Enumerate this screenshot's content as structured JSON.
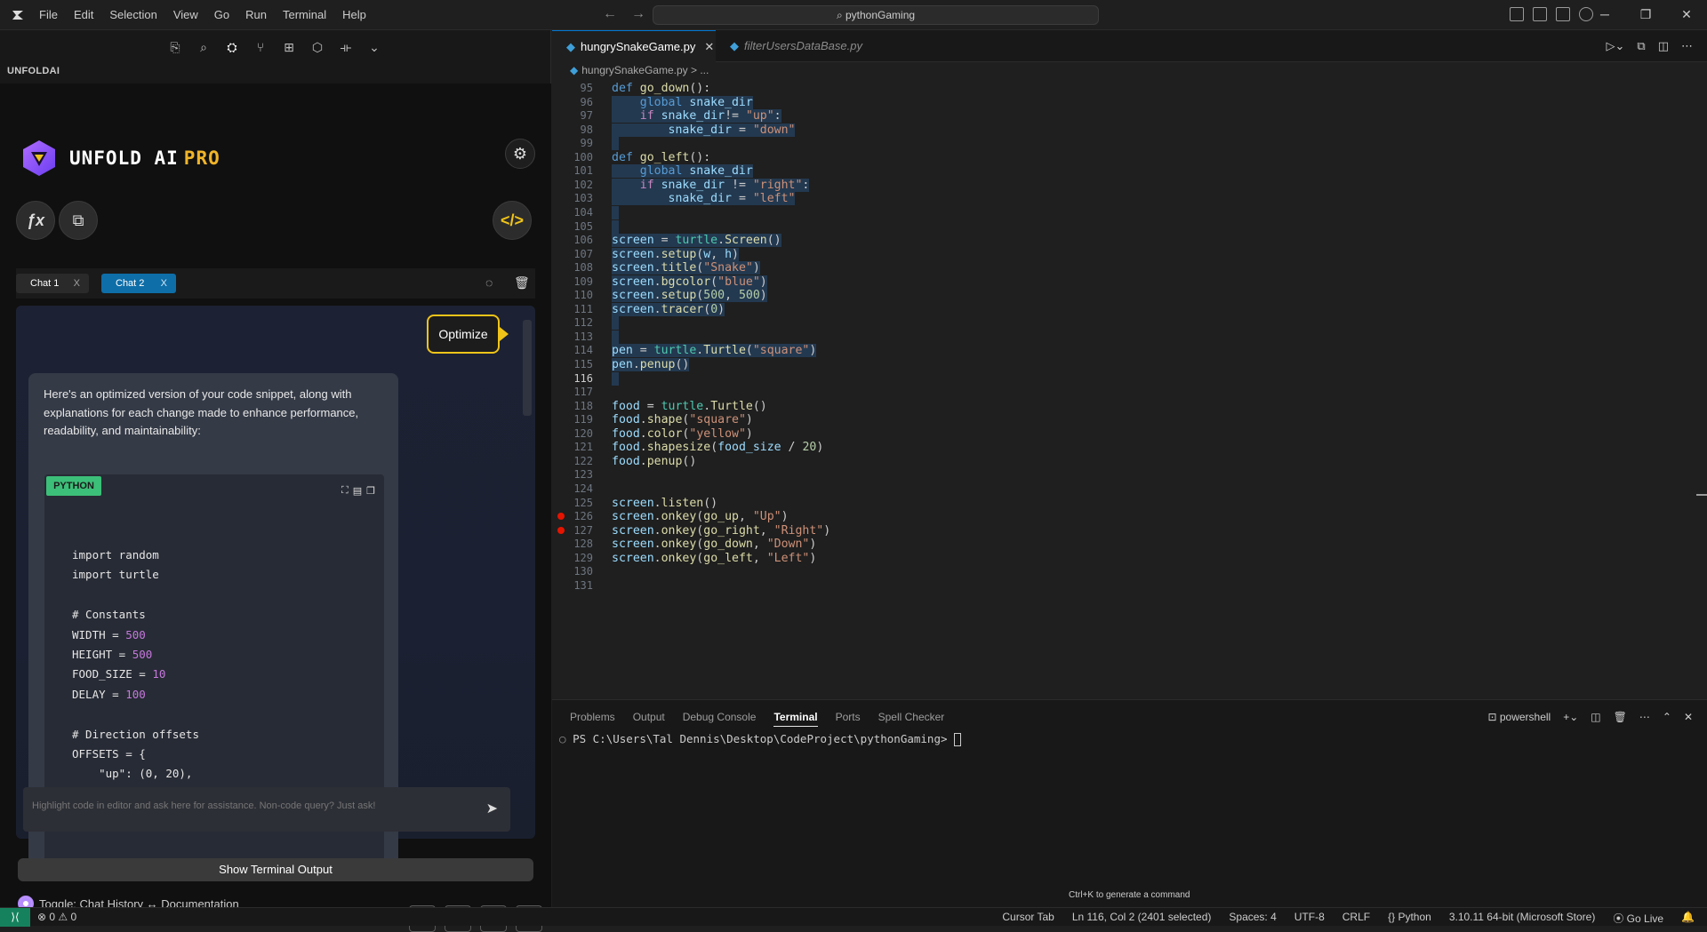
{
  "titlebar": {
    "menu": [
      "File",
      "Edit",
      "Selection",
      "View",
      "Go",
      "Run",
      "Terminal",
      "Help"
    ],
    "search": "pythonGaming",
    "window_controls": [
      "─",
      "❐",
      "✕"
    ]
  },
  "left_panel": {
    "title": "UNFOLDAI",
    "brand_name": "UNFOLD AI",
    "brand_tier": "PRO",
    "fx_icon": "ƒx",
    "chat_tabs": [
      {
        "label": "Chat 1",
        "close": "X"
      },
      {
        "label": "Chat 2",
        "close": "X"
      }
    ],
    "optimize_label": "Optimize",
    "message_text": "Here's an optimized version of your code snippet, along with explanations for each change made to enhance performance, readability, and maintainability:",
    "code_language": "PYTHON",
    "code_lines": [
      {
        "parts": [
          {
            "t": "import random"
          }
        ]
      },
      {
        "parts": [
          {
            "t": "import turtle"
          }
        ]
      },
      {
        "parts": [
          {
            "t": ""
          }
        ]
      },
      {
        "parts": [
          {
            "t": "# Constants"
          }
        ]
      },
      {
        "parts": [
          {
            "t": "WIDTH = "
          },
          {
            "t": "500",
            "c": "num"
          }
        ]
      },
      {
        "parts": [
          {
            "t": "HEIGHT = "
          },
          {
            "t": "500",
            "c": "num"
          }
        ]
      },
      {
        "parts": [
          {
            "t": "FOOD_SIZE = "
          },
          {
            "t": "10",
            "c": "num"
          }
        ]
      },
      {
        "parts": [
          {
            "t": "DELAY = "
          },
          {
            "t": "100",
            "c": "num"
          }
        ]
      },
      {
        "parts": [
          {
            "t": ""
          }
        ]
      },
      {
        "parts": [
          {
            "t": "# Direction offsets"
          }
        ]
      },
      {
        "parts": [
          {
            "t": "OFFSETS = {"
          }
        ]
      },
      {
        "parts": [
          {
            "t": "    \"up\": (0, 20),"
          }
        ]
      }
    ],
    "input_placeholder": "Highlight code in editor and ask here for assistance. Non-code query? Just ask!",
    "show_terminal_label": "Show Terminal Output",
    "toggle_label": "Toggle: Chat History ↔ Documentation"
  },
  "editor": {
    "tabs": [
      {
        "label": "hungrySnakeGame.py",
        "active": true
      },
      {
        "label": "filterUsersDataBase.py",
        "active": false
      }
    ],
    "breadcrumb_file": "hungrySnakeGame.py",
    "breadcrumb_rest": "> ...",
    "current_line": 116,
    "breakpoints": [
      126,
      127
    ],
    "lines": [
      {
        "n": 95,
        "y": 0,
        "sel": false,
        "parts": [
          {
            "t": "def ",
            "c": "kw"
          },
          {
            "t": "go_down",
            "c": "fn"
          },
          {
            "t": "():"
          }
        ]
      },
      {
        "n": 96,
        "y": 1,
        "sel": true,
        "parts": [
          {
            "t": "    "
          },
          {
            "t": "global ",
            "c": "kw"
          },
          {
            "t": "snake_dir",
            "c": "vr"
          }
        ]
      },
      {
        "n": 97,
        "y": 2,
        "sel": true,
        "parts": [
          {
            "t": "    "
          },
          {
            "t": "if ",
            "c": "kwc"
          },
          {
            "t": "snake_dir",
            "c": "vr"
          },
          {
            "t": "!= "
          },
          {
            "t": "\"up\"",
            "c": "str"
          },
          {
            "t": ":"
          }
        ]
      },
      {
        "n": 98,
        "y": 3,
        "sel": true,
        "parts": [
          {
            "t": "        "
          },
          {
            "t": "snake_dir",
            "c": "vr"
          },
          {
            "t": " = "
          },
          {
            "t": "\"down\"",
            "c": "str"
          }
        ]
      },
      {
        "n": 99,
        "y": 4,
        "sel": true,
        "parts": [
          {
            "t": " "
          }
        ]
      },
      {
        "n": 100,
        "y": 5,
        "sel": false,
        "parts": [
          {
            "t": "def ",
            "c": "kw"
          },
          {
            "t": "go_left",
            "c": "fn"
          },
          {
            "t": "():"
          }
        ]
      },
      {
        "n": 101,
        "y": 6,
        "sel": true,
        "parts": [
          {
            "t": "    "
          },
          {
            "t": "global ",
            "c": "kw"
          },
          {
            "t": "snake_dir",
            "c": "vr"
          }
        ]
      },
      {
        "n": 102,
        "y": 7,
        "sel": true,
        "parts": [
          {
            "t": "    "
          },
          {
            "t": "if ",
            "c": "kwc"
          },
          {
            "t": "snake_dir",
            "c": "vr"
          },
          {
            "t": " != "
          },
          {
            "t": "\"right\"",
            "c": "str"
          },
          {
            "t": ":"
          }
        ]
      },
      {
        "n": 103,
        "y": 8,
        "sel": true,
        "parts": [
          {
            "t": "        "
          },
          {
            "t": "snake_dir",
            "c": "vr"
          },
          {
            "t": " = "
          },
          {
            "t": "\"left\"",
            "c": "str"
          }
        ]
      },
      {
        "n": 104,
        "y": 9,
        "sel": true,
        "parts": [
          {
            "t": " "
          }
        ]
      },
      {
        "n": 105,
        "y": 10,
        "sel": true,
        "parts": [
          {
            "t": " "
          }
        ]
      },
      {
        "n": 106,
        "y": 11,
        "sel": true,
        "parts": [
          {
            "t": "screen",
            "c": "vr"
          },
          {
            "t": " = "
          },
          {
            "t": "turtle",
            "c": "md"
          },
          {
            "t": "."
          },
          {
            "t": "Screen",
            "c": "fn"
          },
          {
            "t": "()"
          }
        ]
      },
      {
        "n": 107,
        "y": 12,
        "sel": true,
        "parts": [
          {
            "t": "screen",
            "c": "vr"
          },
          {
            "t": "."
          },
          {
            "t": "setup",
            "c": "fn"
          },
          {
            "t": "("
          },
          {
            "t": "w",
            "c": "vr"
          },
          {
            "t": ", "
          },
          {
            "t": "h",
            "c": "vr"
          },
          {
            "t": ")"
          }
        ]
      },
      {
        "n": 108,
        "y": 13,
        "sel": true,
        "parts": [
          {
            "t": "screen",
            "c": "vr"
          },
          {
            "t": "."
          },
          {
            "t": "title",
            "c": "fn"
          },
          {
            "t": "("
          },
          {
            "t": "\"Snake\"",
            "c": "str"
          },
          {
            "t": ")"
          }
        ]
      },
      {
        "n": 109,
        "y": 14,
        "sel": true,
        "parts": [
          {
            "t": "screen",
            "c": "vr"
          },
          {
            "t": "."
          },
          {
            "t": "bgcolor",
            "c": "fn"
          },
          {
            "t": "("
          },
          {
            "t": "\"blue\"",
            "c": "str"
          },
          {
            "t": ")"
          }
        ]
      },
      {
        "n": 110,
        "y": 15,
        "sel": true,
        "parts": [
          {
            "t": "screen",
            "c": "vr"
          },
          {
            "t": "."
          },
          {
            "t": "setup",
            "c": "fn"
          },
          {
            "t": "("
          },
          {
            "t": "500",
            "c": "nm"
          },
          {
            "t": ", "
          },
          {
            "t": "500",
            "c": "nm"
          },
          {
            "t": ")"
          }
        ]
      },
      {
        "n": 111,
        "y": 16,
        "sel": true,
        "parts": [
          {
            "t": "screen",
            "c": "vr"
          },
          {
            "t": "."
          },
          {
            "t": "tracer",
            "c": "fn"
          },
          {
            "t": "("
          },
          {
            "t": "0",
            "c": "nm"
          },
          {
            "t": ")"
          }
        ]
      },
      {
        "n": 112,
        "y": 17,
        "sel": true,
        "parts": [
          {
            "t": " "
          }
        ]
      },
      {
        "n": 113,
        "y": 18,
        "sel": true,
        "parts": [
          {
            "t": " "
          }
        ]
      },
      {
        "n": 114,
        "y": 19,
        "sel": true,
        "parts": [
          {
            "t": "pen",
            "c": "vr"
          },
          {
            "t": " = "
          },
          {
            "t": "turtle",
            "c": "md"
          },
          {
            "t": "."
          },
          {
            "t": "Turtle",
            "c": "fn"
          },
          {
            "t": "("
          },
          {
            "t": "\"square\"",
            "c": "str"
          },
          {
            "t": ")"
          }
        ]
      },
      {
        "n": 115,
        "y": 20,
        "sel": true,
        "parts": [
          {
            "t": "pen",
            "c": "vr"
          },
          {
            "t": "."
          },
          {
            "t": "penup",
            "c": "fn"
          },
          {
            "t": "()"
          }
        ]
      },
      {
        "n": 116,
        "y": 21,
        "sel": true,
        "parts": [
          {
            "t": " "
          }
        ]
      },
      {
        "n": 117,
        "y": 22,
        "sel": false,
        "parts": [
          {
            "t": ""
          }
        ]
      },
      {
        "n": 118,
        "y": 23,
        "sel": false,
        "parts": [
          {
            "t": "food",
            "c": "vr"
          },
          {
            "t": " = "
          },
          {
            "t": "turtle",
            "c": "md"
          },
          {
            "t": "."
          },
          {
            "t": "Turtle",
            "c": "fn"
          },
          {
            "t": "()"
          }
        ]
      },
      {
        "n": 119,
        "y": 24,
        "sel": false,
        "parts": [
          {
            "t": "food",
            "c": "vr"
          },
          {
            "t": "."
          },
          {
            "t": "shape",
            "c": "fn"
          },
          {
            "t": "("
          },
          {
            "t": "\"square\"",
            "c": "str"
          },
          {
            "t": ")"
          }
        ]
      },
      {
        "n": 120,
        "y": 25,
        "sel": false,
        "parts": [
          {
            "t": "food",
            "c": "vr"
          },
          {
            "t": "."
          },
          {
            "t": "color",
            "c": "fn"
          },
          {
            "t": "("
          },
          {
            "t": "\"yellow\"",
            "c": "str"
          },
          {
            "t": ")"
          }
        ]
      },
      {
        "n": 121,
        "y": 26,
        "sel": false,
        "parts": [
          {
            "t": "food",
            "c": "vr"
          },
          {
            "t": "."
          },
          {
            "t": "shapesize",
            "c": "fn"
          },
          {
            "t": "("
          },
          {
            "t": "food_size",
            "c": "vr"
          },
          {
            "t": " / "
          },
          {
            "t": "20",
            "c": "nm"
          },
          {
            "t": ")"
          }
        ]
      },
      {
        "n": 122,
        "y": 27,
        "sel": false,
        "parts": [
          {
            "t": "food",
            "c": "vr"
          },
          {
            "t": "."
          },
          {
            "t": "penup",
            "c": "fn"
          },
          {
            "t": "()"
          }
        ]
      },
      {
        "n": 123,
        "y": 28,
        "sel": false,
        "parts": [
          {
            "t": ""
          }
        ]
      },
      {
        "n": 124,
        "y": 29,
        "sel": false,
        "parts": [
          {
            "t": ""
          }
        ]
      },
      {
        "n": 125,
        "y": 30,
        "sel": false,
        "parts": [
          {
            "t": "screen",
            "c": "vr"
          },
          {
            "t": "."
          },
          {
            "t": "listen",
            "c": "fn"
          },
          {
            "t": "()"
          }
        ]
      },
      {
        "n": 126,
        "y": 31,
        "sel": false,
        "parts": [
          {
            "t": "screen",
            "c": "vr"
          },
          {
            "t": "."
          },
          {
            "t": "onkey",
            "c": "fn"
          },
          {
            "t": "("
          },
          {
            "t": "go_up",
            "c": "fn"
          },
          {
            "t": ", "
          },
          {
            "t": "\"Up\"",
            "c": "str"
          },
          {
            "t": ")"
          }
        ]
      },
      {
        "n": 127,
        "y": 32,
        "sel": false,
        "parts": [
          {
            "t": "screen",
            "c": "vr"
          },
          {
            "t": "."
          },
          {
            "t": "onkey",
            "c": "fn"
          },
          {
            "t": "("
          },
          {
            "t": "go_right",
            "c": "fn"
          },
          {
            "t": ", "
          },
          {
            "t": "\"Right\"",
            "c": "str"
          },
          {
            "t": ")"
          }
        ]
      },
      {
        "n": 128,
        "y": 33,
        "sel": false,
        "parts": [
          {
            "t": "screen",
            "c": "vr"
          },
          {
            "t": "."
          },
          {
            "t": "onkey",
            "c": "fn"
          },
          {
            "t": "("
          },
          {
            "t": "go_down",
            "c": "fn"
          },
          {
            "t": ", "
          },
          {
            "t": "\"Down\"",
            "c": "str"
          },
          {
            "t": ")"
          }
        ]
      },
      {
        "n": 129,
        "y": 34,
        "sel": false,
        "parts": [
          {
            "t": "screen",
            "c": "vr"
          },
          {
            "t": "."
          },
          {
            "t": "onkey",
            "c": "fn"
          },
          {
            "t": "("
          },
          {
            "t": "go_left",
            "c": "fn"
          },
          {
            "t": ", "
          },
          {
            "t": "\"Left\"",
            "c": "str"
          },
          {
            "t": ")"
          }
        ]
      },
      {
        "n": 130,
        "y": 35,
        "sel": false,
        "parts": [
          {
            "t": ""
          }
        ]
      },
      {
        "n": 131,
        "y": 36,
        "sel": false,
        "parts": [
          {
            "t": ""
          }
        ]
      }
    ]
  },
  "panel": {
    "tabs": [
      "Problems",
      "Output",
      "Debug Console",
      "Terminal",
      "Ports",
      "Spell Checker"
    ],
    "active_tab": "Terminal",
    "shell_name": "powershell",
    "terminal_prompt": "PS C:\\Users\\Tal Dennis\\Desktop\\CodeProject\\pythonGaming> ",
    "hint": "Ctrl+K to generate a command"
  },
  "statusbar": {
    "remote": "⟩⟨",
    "problems": "⊗ 0 ⚠ 0",
    "items": [
      "Cursor Tab",
      "Ln 116, Col 2 (2401 selected)",
      "Spaces: 4",
      "UTF-8",
      "CRLF",
      "{} Python",
      "3.10.11 64-bit (Microsoft Store)",
      "⦿ Go Live",
      "🔔"
    ]
  },
  "colors": {
    "accent_tab": "#0e6ea8",
    "optimize_border": "#f0c419",
    "python_badge": "#3cbf78",
    "brand_pro": "#f0b429",
    "breakpoint": "#e51400",
    "remote": "#16825d"
  },
  "icons": [
    "app-logo-icon",
    "files-icon",
    "search-icon",
    "unfold-icon",
    "source-control-icon",
    "extensions-icon",
    "package-icon",
    "remote-icon",
    "chevron-down-icon",
    "gear-icon",
    "fx-icon",
    "image-edit-icon",
    "code-icon",
    "chat-bubble-icon",
    "trash-icon",
    "send-icon",
    "exit-icon",
    "refresh-icon",
    "message-icon",
    "doc-icon",
    "run-icon",
    "split-icon",
    "more-icon"
  ]
}
